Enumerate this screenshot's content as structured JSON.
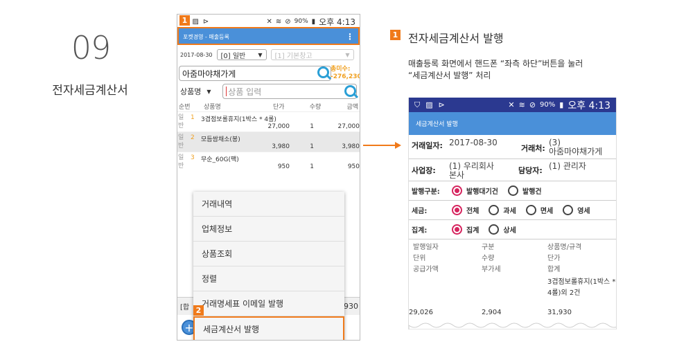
{
  "step": {
    "number": "09",
    "title": "전자세금계산서"
  },
  "badges": {
    "b1": "1",
    "b2": "2",
    "b3": "1"
  },
  "phone1": {
    "status": {
      "battery": "90%",
      "time": "오후 4:13"
    },
    "appbar_title": "포켓경영 - 매출등록",
    "date": "2017-08-30",
    "type_select": "[0] 일반",
    "warehouse_select": "[1] 기본창고",
    "customer": "아줌마야채가게",
    "unpaid_label": "총미수:",
    "unpaid_value": "-276,230",
    "product_label": "상품명",
    "product_placeholder": "상품 입력",
    "headers": {
      "no": "순번",
      "name": "상품명",
      "price": "단가",
      "qty": "수량",
      "amount": "금액"
    },
    "rows": [
      {
        "side": "일반",
        "no": "1",
        "name": "3겹점보롤휴지(1박스 * 4롤)",
        "price": "27,000",
        "qty": "1",
        "amount": "27,000"
      },
      {
        "side": "일반",
        "no": "2",
        "name": "모듬쌈채소(봉)",
        "price": "3,980",
        "qty": "1",
        "amount": "3,980"
      },
      {
        "side": "일반",
        "no": "3",
        "name": "무순_60G(팩)",
        "price": "950",
        "qty": "1",
        "amount": "950"
      }
    ],
    "menu": [
      "거래내역",
      "업체정보",
      "상품조회",
      "정렬",
      "거래명세표 이메일 발행",
      "세금계산서 발행"
    ],
    "bottom_left": "[합",
    "bottom_right": "930",
    "fab": "+"
  },
  "right": {
    "title": "전자세금계산서 발행",
    "desc1": "매출등록 화면에서 핸드폰 “좌측 하단”버튼을 눌러",
    "desc2": "“세금계산서 발행” 처리"
  },
  "phone2": {
    "status": {
      "battery": "90%",
      "time": "오후 4:13"
    },
    "appbar_title": "세금계산서 발행",
    "trade_date_label": "거래일자:",
    "trade_date": "2017-08-30",
    "partner_label": "거래처:",
    "partner_code": "(3)",
    "partner_name": "아줌마야채가게",
    "site_label": "사업장:",
    "site_code": "(1) 우리회사",
    "site_name": "본사",
    "manager_label": "담당자:",
    "manager": "(1) 관리자",
    "issue_label": "발행구분:",
    "issue_opt1": "발행대기건",
    "issue_opt2": "발행건",
    "tax_label": "세금:",
    "tax_opts": [
      "전체",
      "과세",
      "면세",
      "영세"
    ],
    "sum_label": "집계:",
    "sum_opt1": "집계",
    "sum_opt2": "상세",
    "list_headers": {
      "c1": [
        "발행일자",
        "단위",
        "공급가액"
      ],
      "c2": [
        "구분",
        "수량",
        "부가세"
      ],
      "c3": [
        "상품명/규격",
        "단가",
        "합계"
      ]
    },
    "item_name": "3겹점보롤휴지(1박스 * 4롤)외 2건",
    "supply": "29,026",
    "vat": "2,904",
    "total": "31,930"
  }
}
